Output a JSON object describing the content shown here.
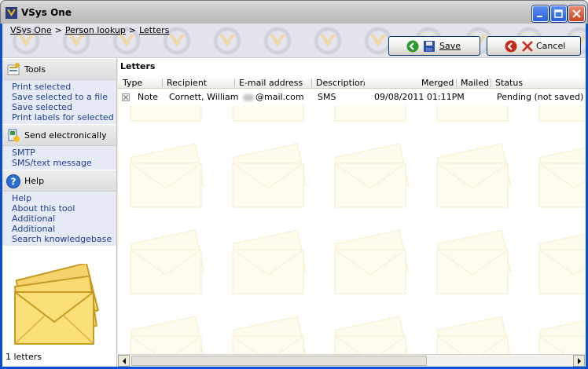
{
  "window": {
    "title": "VSys One"
  },
  "breadcrumb": [
    {
      "label": "VSys One"
    },
    {
      "label": "Person lookup"
    },
    {
      "label": "Letters"
    }
  ],
  "toolbar": {
    "save_label": "Save",
    "cancel_label": "Cancel"
  },
  "sidebar": {
    "tools": {
      "title": "Tools",
      "items": [
        "Print selected",
        "Save selected to a file",
        "Save selected",
        "Print labels for selected"
      ]
    },
    "send": {
      "title": "Send electronically",
      "items": [
        "SMTP",
        "SMS/text message"
      ]
    },
    "help": {
      "title": "Help",
      "items": [
        "Help",
        "About this tool",
        "Additional",
        "Additional",
        "Search knowledgebase"
      ]
    },
    "status_count": "1 letters"
  },
  "main": {
    "section_title": "Letters",
    "columns": {
      "type": "Type",
      "recipient": "Recipient",
      "email": "E-mail address",
      "description": "Description",
      "merged": "Merged",
      "mailed": "Mailed",
      "status": "Status"
    },
    "rows": [
      {
        "type": "Note",
        "recipient": "Cornett, William",
        "email": "@mail.com",
        "description": "SMS",
        "merged": "09/08/2011 01:11PM",
        "mailed": "",
        "status": "Pending (not saved)"
      }
    ]
  },
  "colors": {
    "titlebar": "#c6c6c6",
    "link": "#1b3f8f",
    "group_bg": "#e6eaf5"
  }
}
